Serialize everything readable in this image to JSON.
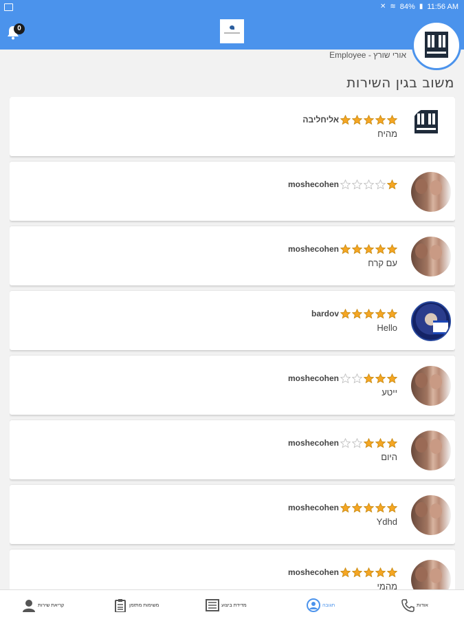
{
  "status_bar": {
    "battery": "84%",
    "time": "11:56 AM"
  },
  "app_bar": {
    "notification_count": "0"
  },
  "header": {
    "employee_line": "אורי שורץ - Employee",
    "section_title": "משוב בגין השירות"
  },
  "reviews": [
    {
      "username": "אליחליבה",
      "rating": 5,
      "comment": "מהיח",
      "avatar": "building-logo"
    },
    {
      "username": "moshecohen",
      "rating": 1,
      "comment": "",
      "avatar": "couple-photo"
    },
    {
      "username": "moshecohen",
      "rating": 5,
      "comment": "עם קרח",
      "avatar": "couple-photo"
    },
    {
      "username": "bardov",
      "rating": 5,
      "comment": "Hello",
      "avatar": "man-with-flag-photo"
    },
    {
      "username": "moshecohen",
      "rating": 3,
      "comment": "ייטע",
      "avatar": "couple-photo"
    },
    {
      "username": "moshecohen",
      "rating": 3,
      "comment": "היום",
      "avatar": "couple-photo"
    },
    {
      "username": "moshecohen",
      "rating": 5,
      "comment": "Ydhd",
      "avatar": "couple-photo"
    },
    {
      "username": "moshecohen",
      "rating": 5,
      "comment": "מהמי",
      "avatar": "couple-photo"
    }
  ],
  "bottom_nav": [
    {
      "label": "קריאת שירות",
      "icon": "service-call-icon",
      "active": false
    },
    {
      "label": "משימות מתזמן",
      "icon": "clipboard-icon",
      "active": false
    },
    {
      "label": "מדידת ביצוע",
      "icon": "report-icon",
      "active": false
    },
    {
      "label": "תגובה",
      "icon": "user-circle-icon",
      "active": true
    },
    {
      "label": "אודות",
      "icon": "phone-icon",
      "active": false
    }
  ],
  "colors": {
    "primary": "#4b93ec",
    "star_filled": "#f5a623",
    "star_empty": "#c0c0c0"
  }
}
